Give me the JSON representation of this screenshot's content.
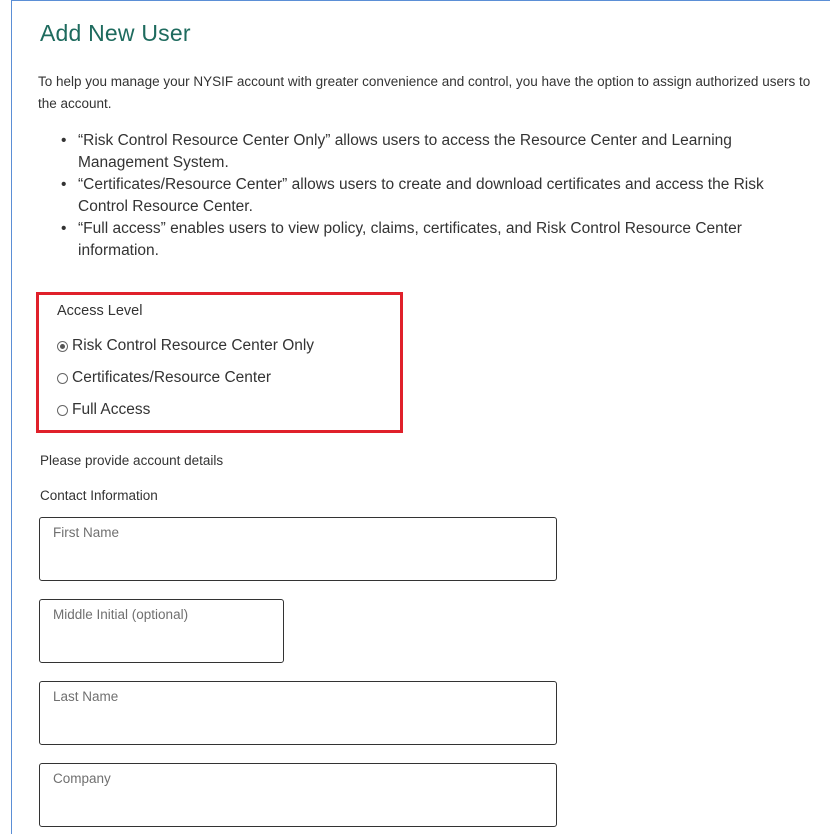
{
  "page": {
    "title": "Add New User",
    "intro": "To help you manage your NYSIF account with greater convenience and control, you have the option to assign authorized users to the account."
  },
  "bullets": [
    "“Risk Control Resource Center Only” allows users to access the Resource Center and Learning Management System.",
    "“Certificates/Resource Center” allows users to create and download certificates and access the Risk Control Resource Center.",
    "“Full access” enables users to view policy, claims, certificates, and Risk Control Resource Center information."
  ],
  "access": {
    "label": "Access Level",
    "options": [
      {
        "label": "Risk Control Resource Center Only",
        "selected": true
      },
      {
        "label": "Certificates/Resource Center",
        "selected": false
      },
      {
        "label": "Full Access",
        "selected": false
      }
    ],
    "highlight_color": "#e0202a"
  },
  "form": {
    "account_details_label": "Please provide account details",
    "contact_info_label": "Contact Information",
    "fields": {
      "first_name": {
        "placeholder": "First Name",
        "value": ""
      },
      "middle_initial": {
        "placeholder": "Middle Initial (optional)",
        "value": ""
      },
      "last_name": {
        "placeholder": "Last Name",
        "value": ""
      },
      "company": {
        "placeholder": "Company",
        "value": ""
      }
    }
  },
  "colors": {
    "title": "#1e6b5e",
    "frame": "#5b8fd6"
  }
}
